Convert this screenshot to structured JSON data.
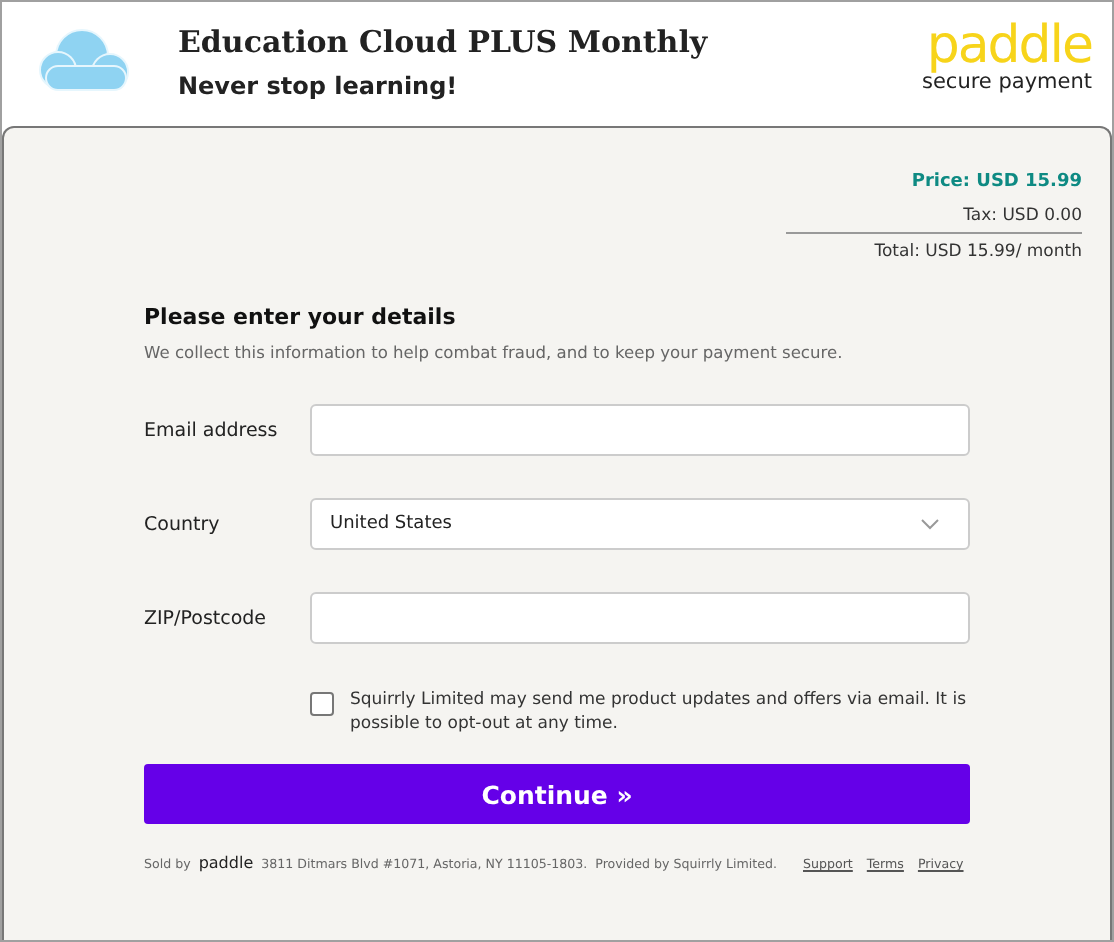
{
  "header": {
    "title": "Education Cloud PLUS Monthly",
    "subtitle": "Never stop learning!",
    "brand": "paddle",
    "brand_caption": "secure payment"
  },
  "summary": {
    "price": "Price: USD 15.99",
    "tax": "Tax: USD 0.00",
    "total": "Total: USD 15.99/ month"
  },
  "form": {
    "heading": "Please enter your details",
    "note": "We collect this information to help combat fraud, and to keep your payment secure.",
    "fields": [
      {
        "kind": "text",
        "label": "Email address"
      },
      {
        "kind": "select",
        "label": "Country",
        "value": "United States"
      },
      {
        "kind": "text",
        "label": "ZIP/Postcode"
      }
    ],
    "consent": {
      "checked": false,
      "text": "Squirrly Limited may send me product updates and offers via email. It is possible to opt-out at any time."
    },
    "button": "Continue »"
  },
  "footer": {
    "sold_by": "Sold by",
    "brand": "paddle",
    "address": "3811 Ditmars Blvd #1071, Astoria, NY 11105-1803.",
    "provided": "Provided by  Squirrly Limited.",
    "links": [
      "Support",
      "Terms",
      "Privacy"
    ]
  }
}
